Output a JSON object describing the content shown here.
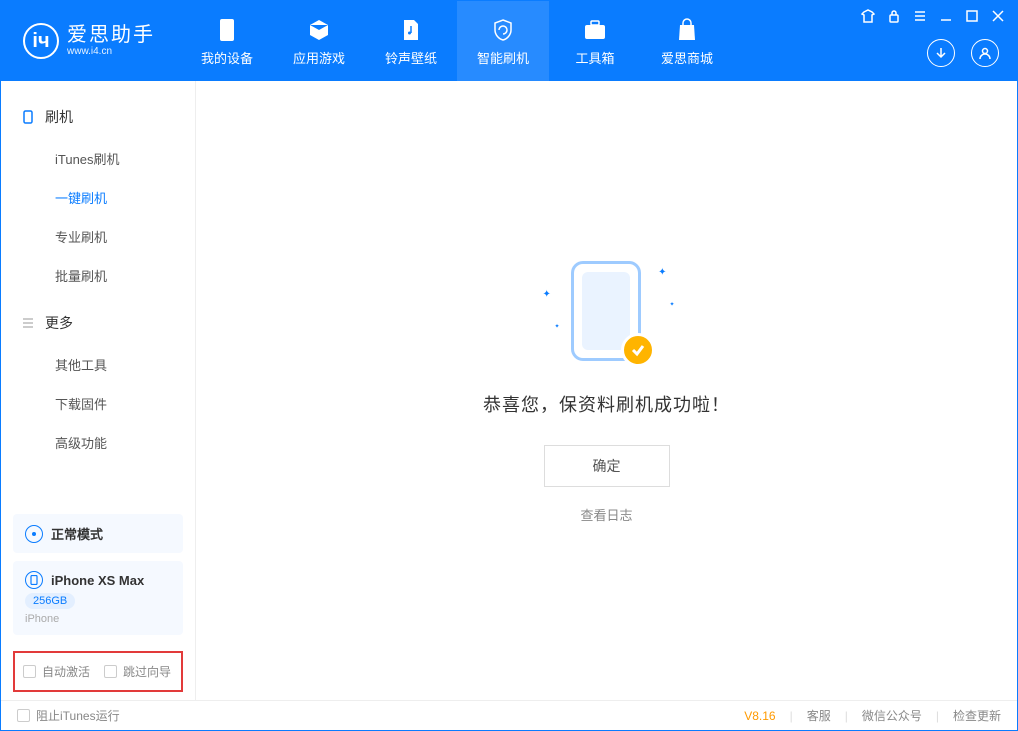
{
  "app": {
    "title": "爱思助手",
    "subtitle": "www.i4.cn"
  },
  "nav": {
    "items": [
      {
        "label": "我的设备"
      },
      {
        "label": "应用游戏"
      },
      {
        "label": "铃声壁纸"
      },
      {
        "label": "智能刷机"
      },
      {
        "label": "工具箱"
      },
      {
        "label": "爱思商城"
      }
    ],
    "active": 3
  },
  "sidebar": {
    "section1": {
      "title": "刷机",
      "items": [
        "iTunes刷机",
        "一键刷机",
        "专业刷机",
        "批量刷机"
      ],
      "active": 1
    },
    "section2": {
      "title": "更多",
      "items": [
        "其他工具",
        "下载固件",
        "高级功能"
      ]
    },
    "mode": {
      "label": "正常模式"
    },
    "device": {
      "name": "iPhone XS Max",
      "capacity": "256GB",
      "type": "iPhone"
    },
    "options": {
      "auto_activate": "自动激活",
      "skip_guide": "跳过向导"
    }
  },
  "main": {
    "success_title": "恭喜您，保资料刷机成功啦！",
    "confirm_label": "确定",
    "log_link": "查看日志"
  },
  "footer": {
    "block_itunes": "阻止iTunes运行",
    "version": "V8.16",
    "service": "客服",
    "wechat": "微信公众号",
    "update": "检查更新"
  }
}
